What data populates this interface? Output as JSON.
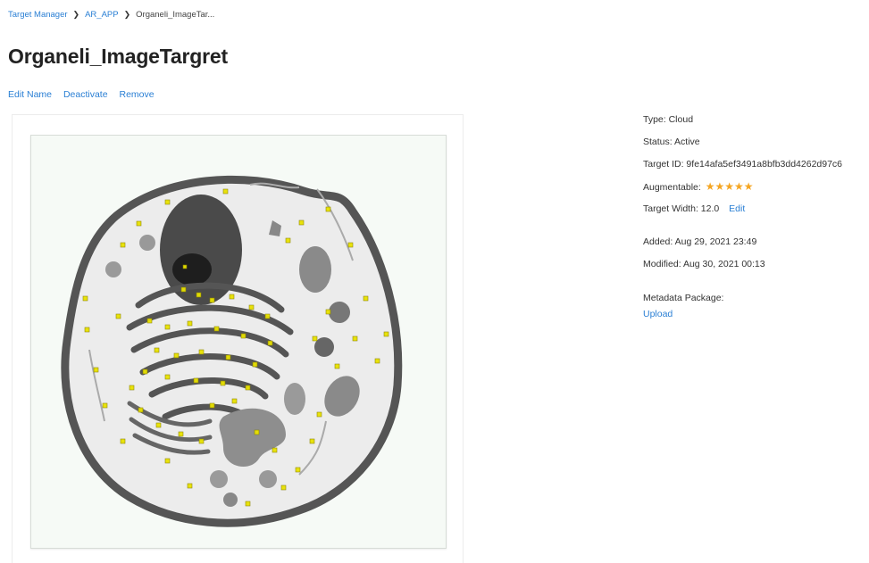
{
  "breadcrumb": {
    "root": "Target Manager",
    "database": "AR_APP",
    "current": "Organeli_ImageTar..."
  },
  "page": {
    "title": "Organeli_ImageTargret"
  },
  "actions": {
    "edit_name": "Edit Name",
    "deactivate": "Deactivate",
    "remove": "Remove"
  },
  "details": {
    "type": "Type: Cloud",
    "status": "Status: Active",
    "target_id": "Target ID: 9fe14afa5ef3491a8bfb3dd4262d97c6",
    "augmentable_label": "Augmentable:",
    "augmentable_rating": 5,
    "augmentable_stars": "★★★★★",
    "target_width": "Target Width: 12.0",
    "edit_width": "Edit",
    "added": "Added: Aug 29, 2021 23:49",
    "modified": "Modified: Aug 30, 2021 00:13",
    "metadata_label": "Metadata Package:",
    "upload": "Upload"
  },
  "colors": {
    "link": "#2a7fd4",
    "star": "#f5a623",
    "feature_marker": "#e8e200",
    "cell_outline": "#555555"
  },
  "icons": {
    "breadcrumb_separator": "chevron-right-icon",
    "rating": "star-icon"
  }
}
